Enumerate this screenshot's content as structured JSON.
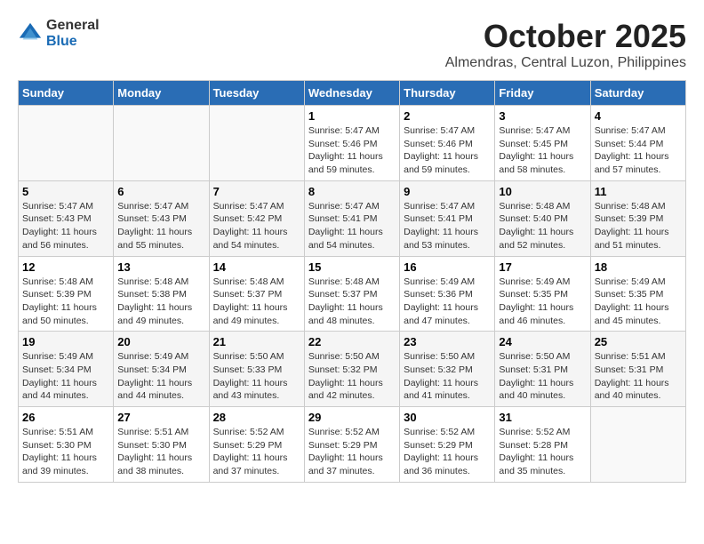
{
  "header": {
    "logo_general": "General",
    "logo_blue": "Blue",
    "month_title": "October 2025",
    "location": "Almendras, Central Luzon, Philippines"
  },
  "calendar": {
    "days_of_week": [
      "Sunday",
      "Monday",
      "Tuesday",
      "Wednesday",
      "Thursday",
      "Friday",
      "Saturday"
    ],
    "weeks": [
      [
        {
          "day": "",
          "info": ""
        },
        {
          "day": "",
          "info": ""
        },
        {
          "day": "",
          "info": ""
        },
        {
          "day": "1",
          "info": "Sunrise: 5:47 AM\nSunset: 5:46 PM\nDaylight: 11 hours\nand 59 minutes."
        },
        {
          "day": "2",
          "info": "Sunrise: 5:47 AM\nSunset: 5:46 PM\nDaylight: 11 hours\nand 59 minutes."
        },
        {
          "day": "3",
          "info": "Sunrise: 5:47 AM\nSunset: 5:45 PM\nDaylight: 11 hours\nand 58 minutes."
        },
        {
          "day": "4",
          "info": "Sunrise: 5:47 AM\nSunset: 5:44 PM\nDaylight: 11 hours\nand 57 minutes."
        }
      ],
      [
        {
          "day": "5",
          "info": "Sunrise: 5:47 AM\nSunset: 5:43 PM\nDaylight: 11 hours\nand 56 minutes."
        },
        {
          "day": "6",
          "info": "Sunrise: 5:47 AM\nSunset: 5:43 PM\nDaylight: 11 hours\nand 55 minutes."
        },
        {
          "day": "7",
          "info": "Sunrise: 5:47 AM\nSunset: 5:42 PM\nDaylight: 11 hours\nand 54 minutes."
        },
        {
          "day": "8",
          "info": "Sunrise: 5:47 AM\nSunset: 5:41 PM\nDaylight: 11 hours\nand 54 minutes."
        },
        {
          "day": "9",
          "info": "Sunrise: 5:47 AM\nSunset: 5:41 PM\nDaylight: 11 hours\nand 53 minutes."
        },
        {
          "day": "10",
          "info": "Sunrise: 5:48 AM\nSunset: 5:40 PM\nDaylight: 11 hours\nand 52 minutes."
        },
        {
          "day": "11",
          "info": "Sunrise: 5:48 AM\nSunset: 5:39 PM\nDaylight: 11 hours\nand 51 minutes."
        }
      ],
      [
        {
          "day": "12",
          "info": "Sunrise: 5:48 AM\nSunset: 5:39 PM\nDaylight: 11 hours\nand 50 minutes."
        },
        {
          "day": "13",
          "info": "Sunrise: 5:48 AM\nSunset: 5:38 PM\nDaylight: 11 hours\nand 49 minutes."
        },
        {
          "day": "14",
          "info": "Sunrise: 5:48 AM\nSunset: 5:37 PM\nDaylight: 11 hours\nand 49 minutes."
        },
        {
          "day": "15",
          "info": "Sunrise: 5:48 AM\nSunset: 5:37 PM\nDaylight: 11 hours\nand 48 minutes."
        },
        {
          "day": "16",
          "info": "Sunrise: 5:49 AM\nSunset: 5:36 PM\nDaylight: 11 hours\nand 47 minutes."
        },
        {
          "day": "17",
          "info": "Sunrise: 5:49 AM\nSunset: 5:35 PM\nDaylight: 11 hours\nand 46 minutes."
        },
        {
          "day": "18",
          "info": "Sunrise: 5:49 AM\nSunset: 5:35 PM\nDaylight: 11 hours\nand 45 minutes."
        }
      ],
      [
        {
          "day": "19",
          "info": "Sunrise: 5:49 AM\nSunset: 5:34 PM\nDaylight: 11 hours\nand 44 minutes."
        },
        {
          "day": "20",
          "info": "Sunrise: 5:49 AM\nSunset: 5:34 PM\nDaylight: 11 hours\nand 44 minutes."
        },
        {
          "day": "21",
          "info": "Sunrise: 5:50 AM\nSunset: 5:33 PM\nDaylight: 11 hours\nand 43 minutes."
        },
        {
          "day": "22",
          "info": "Sunrise: 5:50 AM\nSunset: 5:32 PM\nDaylight: 11 hours\nand 42 minutes."
        },
        {
          "day": "23",
          "info": "Sunrise: 5:50 AM\nSunset: 5:32 PM\nDaylight: 11 hours\nand 41 minutes."
        },
        {
          "day": "24",
          "info": "Sunrise: 5:50 AM\nSunset: 5:31 PM\nDaylight: 11 hours\nand 40 minutes."
        },
        {
          "day": "25",
          "info": "Sunrise: 5:51 AM\nSunset: 5:31 PM\nDaylight: 11 hours\nand 40 minutes."
        }
      ],
      [
        {
          "day": "26",
          "info": "Sunrise: 5:51 AM\nSunset: 5:30 PM\nDaylight: 11 hours\nand 39 minutes."
        },
        {
          "day": "27",
          "info": "Sunrise: 5:51 AM\nSunset: 5:30 PM\nDaylight: 11 hours\nand 38 minutes."
        },
        {
          "day": "28",
          "info": "Sunrise: 5:52 AM\nSunset: 5:29 PM\nDaylight: 11 hours\nand 37 minutes."
        },
        {
          "day": "29",
          "info": "Sunrise: 5:52 AM\nSunset: 5:29 PM\nDaylight: 11 hours\nand 37 minutes."
        },
        {
          "day": "30",
          "info": "Sunrise: 5:52 AM\nSunset: 5:29 PM\nDaylight: 11 hours\nand 36 minutes."
        },
        {
          "day": "31",
          "info": "Sunrise: 5:52 AM\nSunset: 5:28 PM\nDaylight: 11 hours\nand 35 minutes."
        },
        {
          "day": "",
          "info": ""
        }
      ]
    ]
  }
}
